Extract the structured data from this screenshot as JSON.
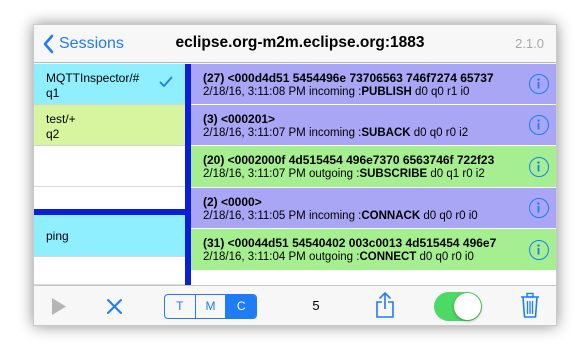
{
  "colors": {
    "accent": "#1e7cf6",
    "divider": "#0a20d8",
    "subscription_selected": "#8fefff",
    "subscription_alt": "#d6f59e",
    "command_row": "#8fefff",
    "msg_incoming": "#a9a6f5",
    "msg_outgoing": "#a6ef90",
    "toggle_on": "#4cd964"
  },
  "navbar": {
    "back_label": "Sessions",
    "back_icon": "chevron-left-icon",
    "title": "eclipse.org-m2m.eclipse.org:1883",
    "version": "2.1.0"
  },
  "subscriptions": [
    {
      "topic": "MQTTInspector/#",
      "qos": "q1",
      "selected": true
    },
    {
      "topic": "test/+",
      "qos": "q2",
      "selected": false
    }
  ],
  "commands": [
    {
      "label": "ping"
    }
  ],
  "messages": [
    {
      "line1": "(27) <000d4d51 5454496e 73706563 746f7274 65737",
      "timestamp": "2/18/16, 3:11:08 PM",
      "direction": "incoming",
      "type": "PUBLISH",
      "flags": "d0 q0 r1 i0"
    },
    {
      "line1": "(3) <000201>",
      "timestamp": "2/18/16, 3:11:07 PM",
      "direction": "incoming",
      "type": "SUBACK",
      "flags": "d0 q0 r0 i2"
    },
    {
      "line1": "(20) <0002000f 4d515454 496e7370 6563746f 722f23",
      "timestamp": "2/18/16, 3:11:07 PM",
      "direction": "outgoing",
      "type": "SUBSCRIBE",
      "flags": "d0 q1 r0 i2"
    },
    {
      "line1": "(2) <0000>",
      "timestamp": "2/18/16, 3:11:05 PM",
      "direction": "incoming",
      "type": "CONNACK",
      "flags": "d0 q0 r0 i0"
    },
    {
      "line1": "(31) <00044d51 54540402 003c0013 4d515454 496e7",
      "timestamp": "2/18/16, 3:11:04 PM",
      "direction": "outgoing",
      "type": "CONNECT",
      "flags": "d0 q0 r0 i0"
    }
  ],
  "toolbar": {
    "play_icon": "play-icon",
    "clear_icon": "close-icon",
    "segments": [
      {
        "label": "T",
        "active": false
      },
      {
        "label": "M",
        "active": false
      },
      {
        "label": "C",
        "active": true
      }
    ],
    "count": "5",
    "share_icon": "share-icon",
    "toggle_on": true,
    "trash_icon": "trash-icon"
  }
}
